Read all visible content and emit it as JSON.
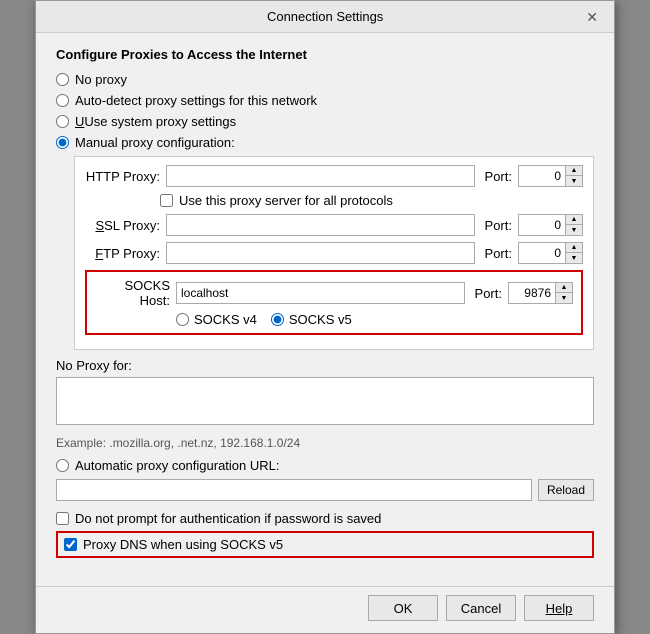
{
  "dialog": {
    "title": "Connection Settings",
    "close_label": "✕"
  },
  "section": {
    "heading": "Configure Proxies to Access the Internet"
  },
  "proxy_options": [
    {
      "id": "no-proxy",
      "label": "No proxy",
      "selected": false
    },
    {
      "id": "auto-detect",
      "label": "Auto-detect proxy settings for this network",
      "selected": false
    },
    {
      "id": "system-proxy",
      "label": "Use system proxy settings",
      "selected": false
    },
    {
      "id": "manual-proxy",
      "label": "Manual proxy configuration:",
      "selected": true
    }
  ],
  "manual": {
    "http_label": "HTTP Proxy:",
    "http_value": "",
    "http_port_label": "Port:",
    "http_port_value": "0",
    "use_for_all_label": "Use this proxy server for all protocols",
    "ssl_label": "SSL Proxy:",
    "ssl_value": "",
    "ssl_port_label": "Port:",
    "ssl_port_value": "0",
    "ftp_label": "FTP Proxy:",
    "ftp_value": "",
    "ftp_port_label": "Port:",
    "ftp_port_value": "0",
    "socks_label": "SOCKS Host:",
    "socks_value": "localhost",
    "socks_port_label": "Port:",
    "socks_port_value": "9876",
    "socks_v4_label": "SOCKS v4",
    "socks_v5_label": "SOCKS v5",
    "socks_v4_selected": false,
    "socks_v5_selected": true
  },
  "no_proxy": {
    "label": "No Proxy for:",
    "value": ""
  },
  "example": {
    "text": "Example: .mozilla.org, .net.nz, 192.168.1.0/24"
  },
  "auto_proxy": {
    "label": "Automatic proxy configuration URL:",
    "value": "",
    "reload_label": "Reload"
  },
  "checkboxes": {
    "no_auth_label": "Do not prompt for authentication if password is saved",
    "no_auth_checked": false,
    "proxy_dns_label": "Proxy DNS when using SOCKS v5",
    "proxy_dns_checked": true
  },
  "buttons": {
    "ok": "OK",
    "cancel": "Cancel",
    "help": "Help"
  }
}
